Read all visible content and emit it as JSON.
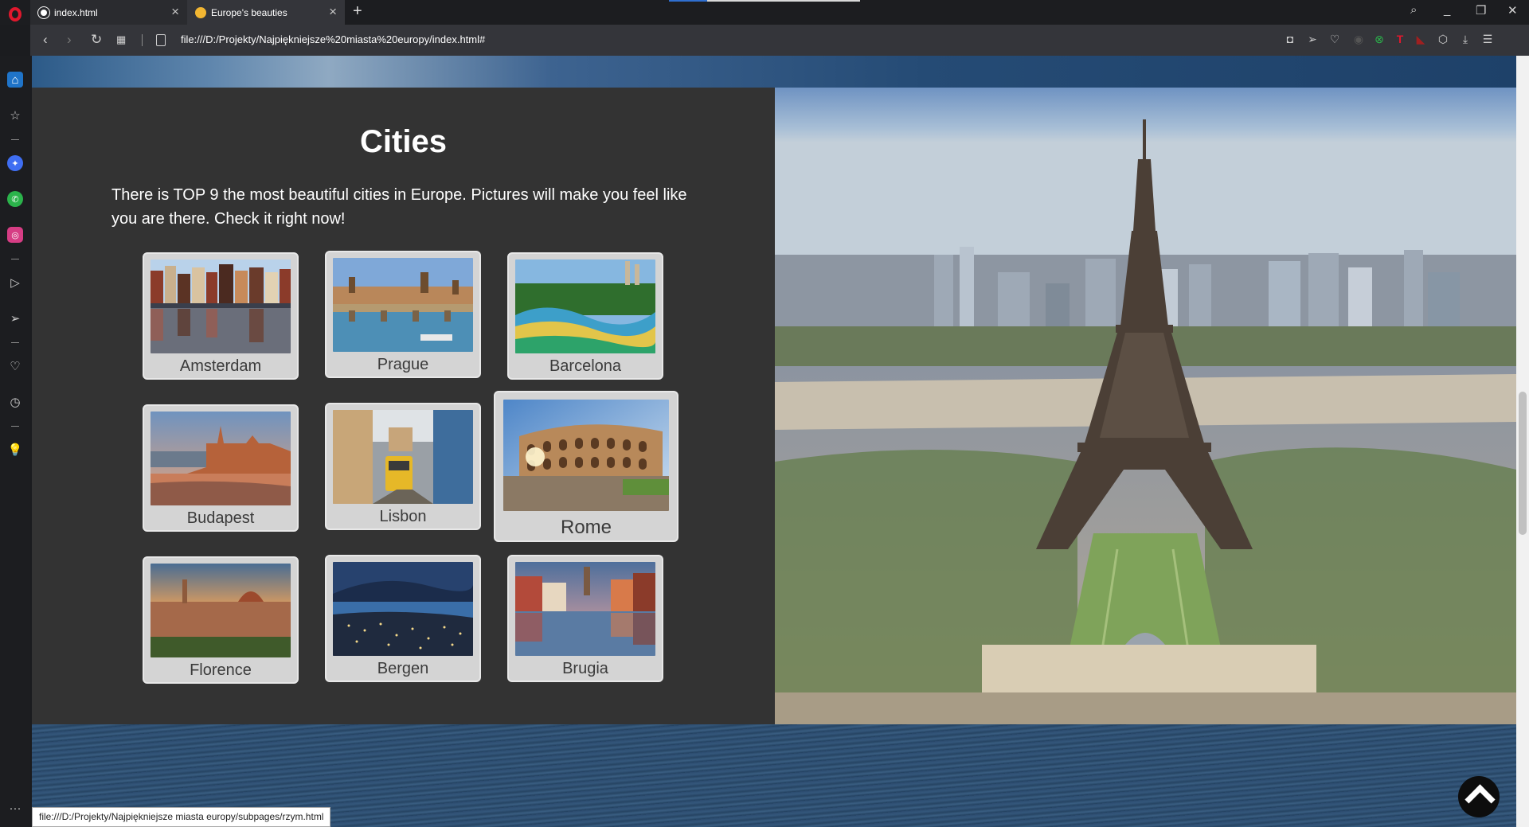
{
  "browser": {
    "tabs": [
      {
        "title": "index.html",
        "active": false
      },
      {
        "title": "Europe's beauties",
        "active": true
      }
    ],
    "url": "file:///D:/Projekty/Najpiękniejsze%20miasta%20europy/index.html#",
    "status_url": "file:///D:/Projekty/Najpiękniejsze miasta europy/subpages/rzym.html",
    "accent_color": "#e0182d"
  },
  "page": {
    "heading": "Cities",
    "intro": "There is TOP 9 the most beautiful cities in Europe. Pictures will make you feel like you are there. Check it right now!",
    "cities": [
      {
        "name": "Amsterdam",
        "hovered": false
      },
      {
        "name": "Prague",
        "hovered": false
      },
      {
        "name": "Barcelona",
        "hovered": false
      },
      {
        "name": "Budapest",
        "hovered": false
      },
      {
        "name": "Lisbon",
        "hovered": false
      },
      {
        "name": "Rome",
        "hovered": true
      },
      {
        "name": "Florence",
        "hovered": false
      },
      {
        "name": "Bergen",
        "hovered": false
      },
      {
        "name": "Brugia",
        "hovered": false
      }
    ],
    "hero_image": "eiffel-tower-paris-photo",
    "panel_color": "#333333",
    "card_color": "#d4d4d4"
  }
}
